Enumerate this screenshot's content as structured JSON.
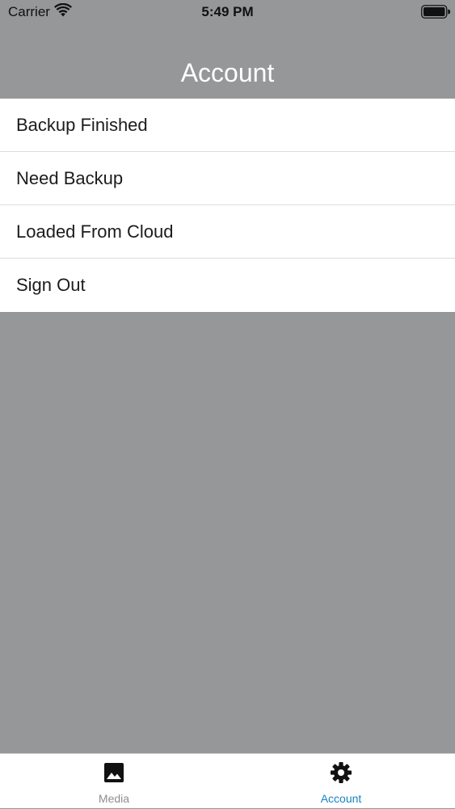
{
  "status_bar": {
    "carrier": "Carrier",
    "time": "5:49 PM",
    "wifi_icon": "wifi-icon",
    "battery_icon": "battery-icon"
  },
  "nav": {
    "title": "Account"
  },
  "menu": {
    "items": [
      {
        "label": "Backup Finished"
      },
      {
        "label": "Need Backup"
      },
      {
        "label": "Loaded From Cloud"
      },
      {
        "label": "Sign Out"
      }
    ]
  },
  "tab_bar": {
    "tabs": [
      {
        "label": "Media",
        "icon": "photo-icon",
        "selected": false
      },
      {
        "label": "Account",
        "icon": "gear-icon",
        "selected": true
      }
    ]
  },
  "colors": {
    "background": "#969798",
    "list_background": "#ffffff",
    "tab_active": "#1a82c6",
    "tab_inactive": "#8e8e93"
  }
}
